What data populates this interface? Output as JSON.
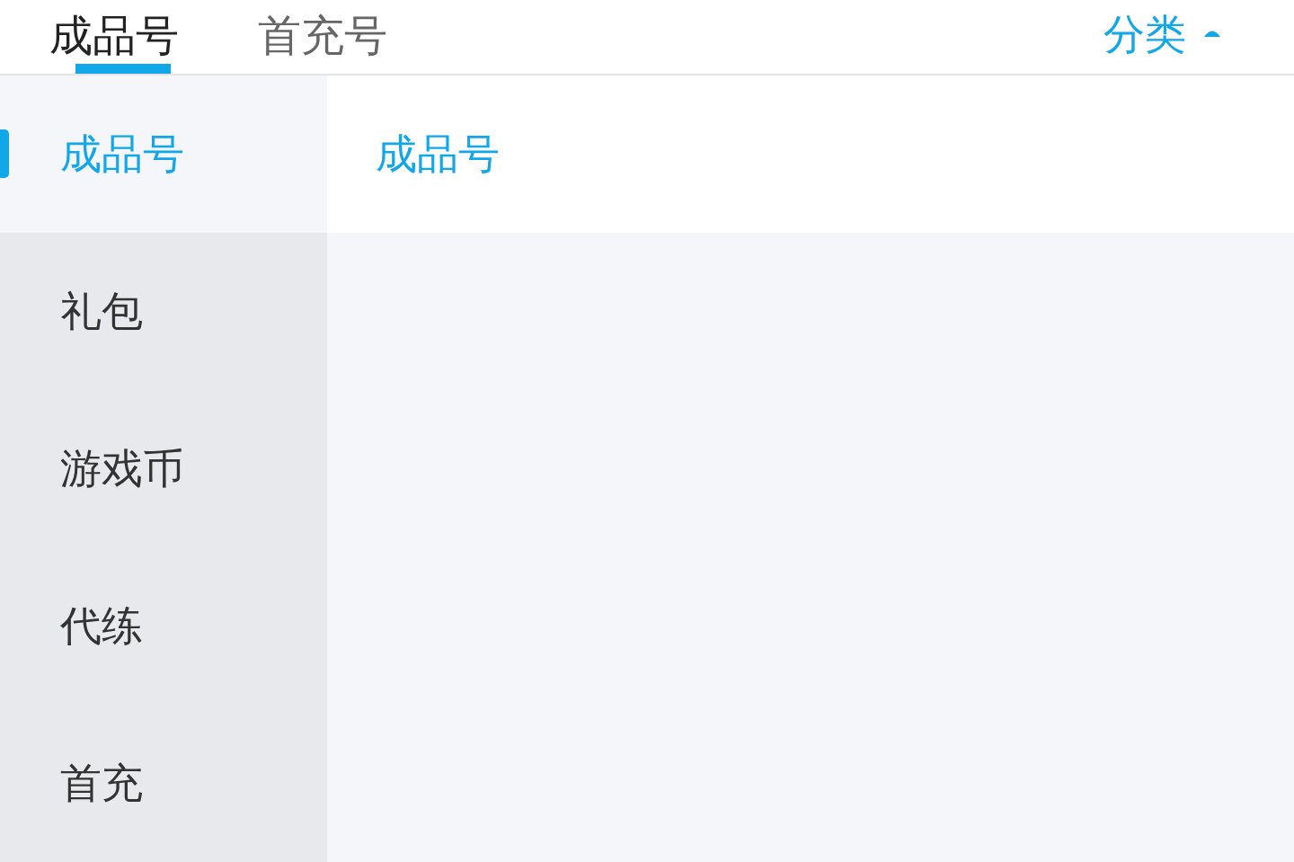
{
  "tabs": [
    {
      "label": "成品号",
      "selected": true
    },
    {
      "label": "首充号",
      "selected": false
    }
  ],
  "category_button": {
    "label": "分类",
    "expanded": true
  },
  "sidebar": {
    "items": [
      {
        "label": "成品号",
        "selected": true
      },
      {
        "label": "礼包",
        "selected": false
      },
      {
        "label": "游戏币",
        "selected": false
      },
      {
        "label": "代练",
        "selected": false
      },
      {
        "label": "首充",
        "selected": false
      }
    ]
  },
  "content": {
    "heading": "成品号"
  }
}
